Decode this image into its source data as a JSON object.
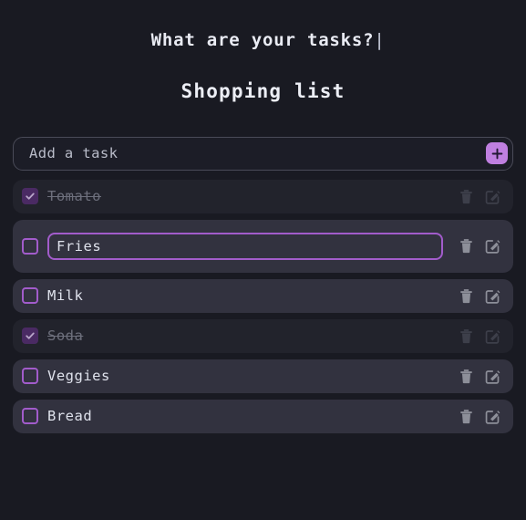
{
  "header": {
    "title": "What are your tasks?",
    "caret": "|",
    "subtitle": "Shopping list"
  },
  "add_task": {
    "placeholder": "Add a task",
    "value": "",
    "button_label": "+",
    "button_icon": "plus-icon",
    "accent_color": "#bf7fe0"
  },
  "icons": {
    "delete": "trash-icon",
    "edit": "edit-pencil-icon",
    "check": "check-icon"
  },
  "colors": {
    "page_background": "#191a22",
    "row_background": "#32323f",
    "row_completed_background": "#22232c",
    "accent_purple": "#a25ccb",
    "add_button": "#bf7fe0",
    "text": "#dfe2ec",
    "text_muted": "#6d6f7c"
  },
  "tasks": [
    {
      "label": "Tomato",
      "completed": true,
      "editing": false
    },
    {
      "label": "Fries",
      "completed": false,
      "editing": true
    },
    {
      "label": "Milk",
      "completed": false,
      "editing": false
    },
    {
      "label": "Soda",
      "completed": true,
      "editing": false
    },
    {
      "label": "Veggies",
      "completed": false,
      "editing": false
    },
    {
      "label": "Bread",
      "completed": false,
      "editing": false
    }
  ]
}
